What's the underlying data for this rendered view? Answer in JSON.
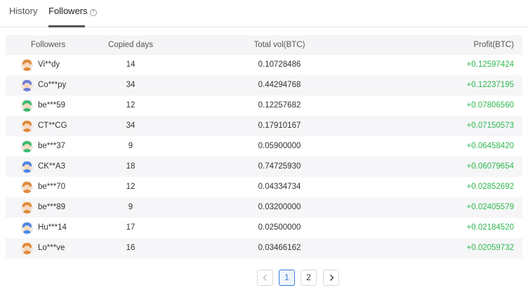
{
  "tabs": {
    "history": "History",
    "followers": "Followers"
  },
  "table": {
    "headers": {
      "followers": "Followers",
      "copied_days": "Copied days",
      "total_vol": "Total vol(BTC)",
      "profit": "Profit(BTC)"
    },
    "rows": [
      {
        "name": "Vi**dy",
        "days": "14",
        "vol": "0.10728486",
        "profit": "+0.12597424",
        "avatar_color": "#e0893a"
      },
      {
        "name": "Co***py",
        "days": "34",
        "vol": "0.44294768",
        "profit": "+0.12237195",
        "avatar_color": "#6b7fd7"
      },
      {
        "name": "be***59",
        "days": "12",
        "vol": "0.12257682",
        "profit": "+0.07806560",
        "avatar_color": "#3cba6e"
      },
      {
        "name": "CT**CG",
        "days": "34",
        "vol": "0.17910167",
        "profit": "+0.07150573",
        "avatar_color": "#e0893a"
      },
      {
        "name": "be***37",
        "days": "9",
        "vol": "0.05900000",
        "profit": "+0.06458420",
        "avatar_color": "#3cba6e"
      },
      {
        "name": "CK**A3",
        "days": "18",
        "vol": "0.74725930",
        "profit": "+0.06079654",
        "avatar_color": "#4a86e8"
      },
      {
        "name": "be***70",
        "days": "12",
        "vol": "0.04334734",
        "profit": "+0.02852692",
        "avatar_color": "#e0893a"
      },
      {
        "name": "be***89",
        "days": "9",
        "vol": "0.03200000",
        "profit": "+0.02405579",
        "avatar_color": "#e0893a"
      },
      {
        "name": "Hu***14",
        "days": "17",
        "vol": "0.02500000",
        "profit": "+0.02184520",
        "avatar_color": "#4a86e8"
      },
      {
        "name": "Lo***ve",
        "days": "16",
        "vol": "0.03466162",
        "profit": "+0.02059732",
        "avatar_color": "#e0893a"
      }
    ]
  },
  "pagination": {
    "pages": [
      "1",
      "2"
    ],
    "current": "1"
  },
  "colors": {
    "profit_positive": "#2fb84f",
    "active_page": "#3a7bd5"
  }
}
